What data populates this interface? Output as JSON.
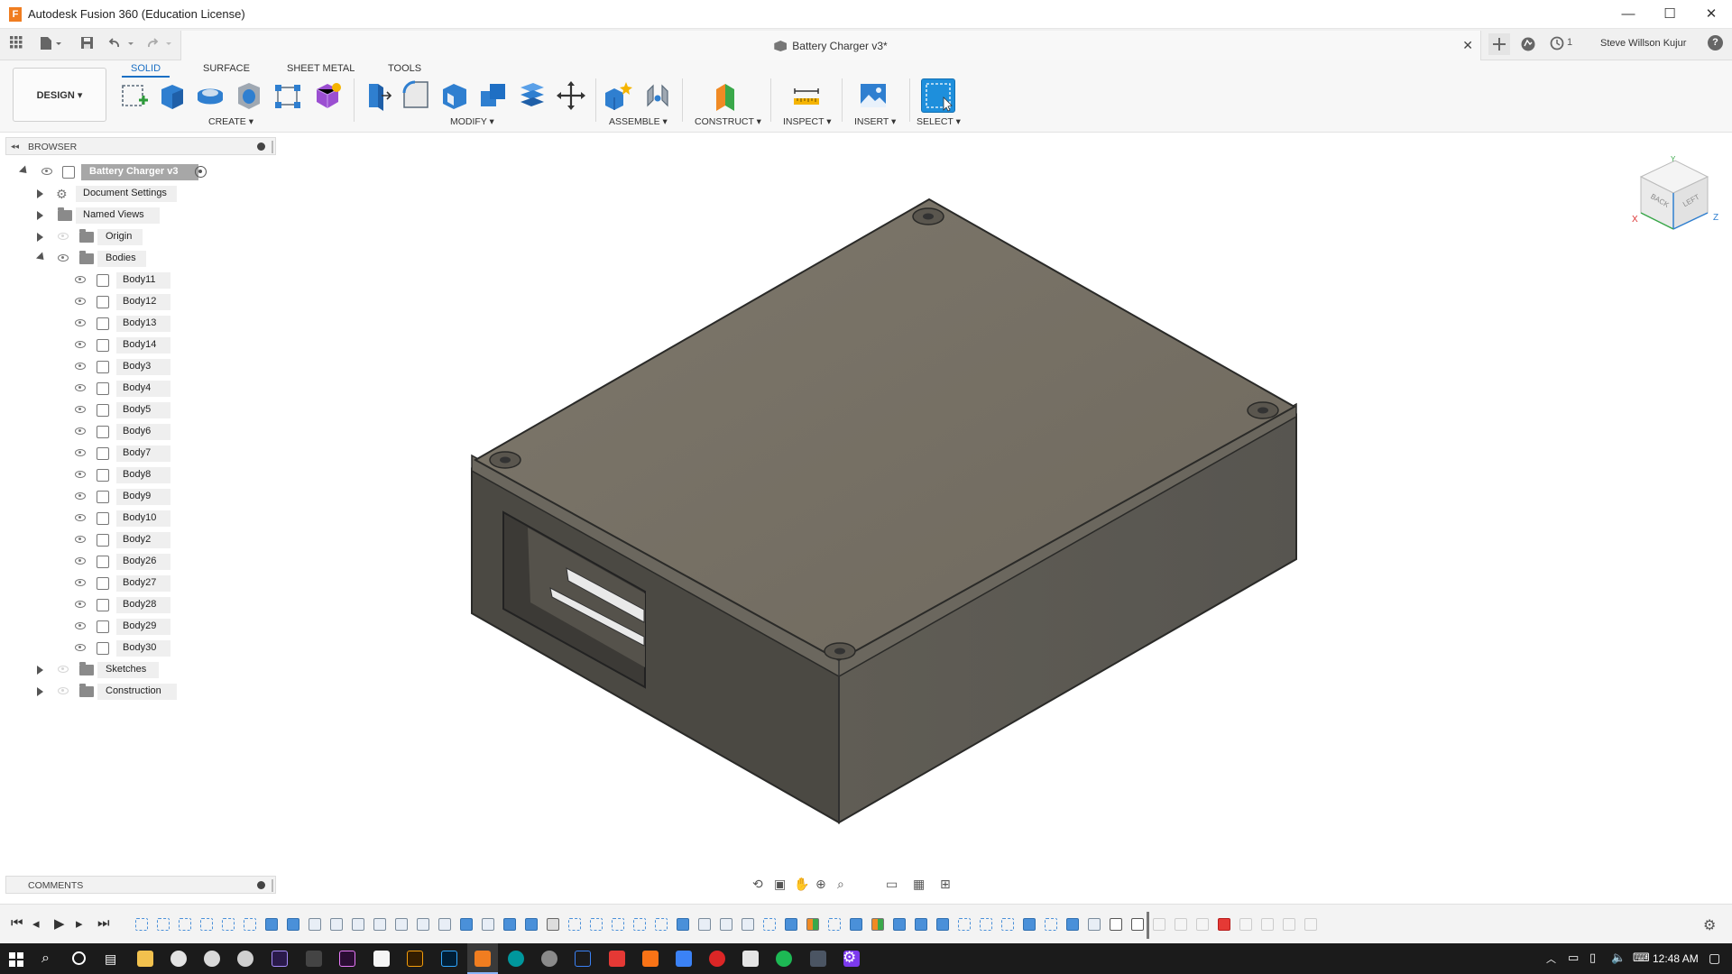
{
  "window": {
    "app_title": "Autodesk Fusion 360 (Education License)",
    "app_icon_letter": "F",
    "minimize": "—",
    "maximize": "☐",
    "close": "✕"
  },
  "tabs": {
    "document_title": "Battery Charger v3*",
    "close_glyph": "✕",
    "job_count": "1",
    "user_name": "Steve Willson Kujur",
    "help_glyph": "?"
  },
  "toolbar": {
    "workspace": "DESIGN ▾",
    "tabs": [
      "SOLID",
      "SURFACE",
      "SHEET METAL",
      "TOOLS"
    ],
    "groups": [
      "CREATE ▾",
      "MODIFY ▾",
      "ASSEMBLE ▾",
      "CONSTRUCT ▾",
      "INSPECT ▾",
      "INSERT ▾",
      "SELECT ▾"
    ]
  },
  "browser": {
    "header": "BROWSER",
    "root": "Battery Charger v3",
    "items": [
      "Document Settings",
      "Named Views",
      "Origin",
      "Bodies"
    ],
    "bodies": [
      "Body11",
      "Body12",
      "Body13",
      "Body14",
      "Body3",
      "Body4",
      "Body5",
      "Body6",
      "Body7",
      "Body8",
      "Body9",
      "Body10",
      "Body2",
      "Body26",
      "Body27",
      "Body28",
      "Body29",
      "Body30"
    ],
    "after": [
      "Sketches",
      "Construction"
    ]
  },
  "viewcube": {
    "back": "BACK",
    "left": "LEFT",
    "x": "X",
    "z": "Z",
    "y": "Y"
  },
  "comments": {
    "header": "COMMENTS"
  },
  "taskbar": {
    "time": "12:48 AM"
  },
  "colors": {
    "accent": "#1a6fc4",
    "model_top": "#7a7366",
    "model_side": "#5a574f",
    "model_front": "#4b4943"
  }
}
